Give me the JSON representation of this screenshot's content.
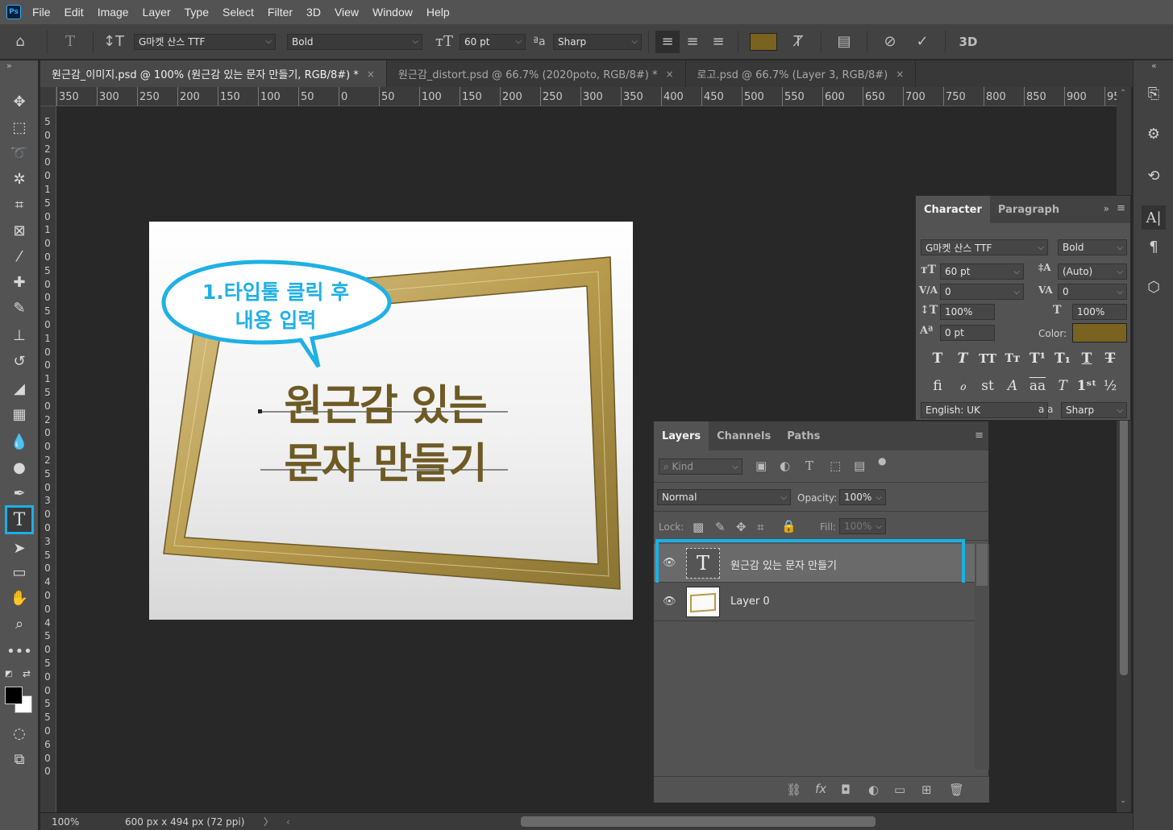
{
  "menu": [
    "File",
    "Edit",
    "Image",
    "Layer",
    "Type",
    "Select",
    "Filter",
    "3D",
    "View",
    "Window",
    "Help"
  ],
  "app_icon": "Ps",
  "options": {
    "font_family": "G마켓 산스 TTF",
    "font_style": "Bold",
    "font_size": "60 pt",
    "antialias": "Sharp",
    "text_color": "#7a6220"
  },
  "tabs": [
    {
      "label": "원근감_이미지.psd @ 100% (원근감 있는  문자 만들기, RGB/8#) *",
      "close": "×",
      "active": true
    },
    {
      "label": "원근감_distort.psd @ 66.7% (2020poto, RGB/8#) *",
      "close": "×",
      "active": false
    },
    {
      "label": "로고.psd @ 66.7% (Layer 3, RGB/8#)",
      "close": "×",
      "active": false
    }
  ],
  "ruler_top": [
    "350",
    "300",
    "250",
    "200",
    "150",
    "100",
    "50",
    "0",
    "50",
    "100",
    "150",
    "200",
    "250",
    "300",
    "350",
    "400",
    "450",
    "500",
    "550",
    "600",
    "650",
    "700",
    "750",
    "800",
    "850",
    "900",
    "95"
  ],
  "ruler_left": [
    "5",
    "0",
    "2",
    "0",
    "0",
    "1",
    "5",
    "0",
    "1",
    "0",
    "0",
    "5",
    "0",
    "0",
    "5",
    "0",
    "1",
    "0",
    "0",
    "1",
    "5",
    "0",
    "2",
    "0",
    "0",
    "2",
    "5",
    "0",
    "3",
    "0",
    "0",
    "3",
    "5",
    "0",
    "4",
    "0",
    "0",
    "4",
    "5",
    "0",
    "5",
    "0",
    "0",
    "5",
    "5",
    "0",
    "6",
    "0",
    "0"
  ],
  "canvas": {
    "bubble_line1": "1.타입툴 클릭 후",
    "bubble_line2": "내용 입력",
    "title_line1": "원근감 있는",
    "title_line2": "문자 만들기",
    "title_color": "#6e5a24",
    "bubble_color": "#1fb0e6"
  },
  "status": {
    "zoom": "100%",
    "doc_size": "600 px x 494 px (72 ppi)",
    "arrow": "〉"
  },
  "character": {
    "tab_active": "Character",
    "tab_other": "Paragraph",
    "font_family": "G마켓 산스 TTF",
    "font_style": "Bold",
    "size": "60 pt",
    "leading": "(Auto)",
    "kerning": "0",
    "tracking": "0",
    "vscale": "100%",
    "hscale": "100%",
    "baseline": "0 pt",
    "color_label": "Color:",
    "color": "#7a6220",
    "language": "English: UK",
    "antialias": "Sharp",
    "aa_label": "a a"
  },
  "layers": {
    "tab_active": "Layers",
    "tab_channels": "Channels",
    "tab_paths": "Paths",
    "kind": "Kind",
    "blend_mode": "Normal",
    "opacity_label": "Opacity:",
    "opacity": "100%",
    "lock_label": "Lock:",
    "fill_label": "Fill:",
    "fill": "100%",
    "items": [
      {
        "name": "원근감 있는  문자 만들기",
        "type": "text",
        "selected": true
      },
      {
        "name": "Layer 0",
        "type": "image",
        "selected": false
      }
    ],
    "highlight_color": "#19b1e6"
  }
}
